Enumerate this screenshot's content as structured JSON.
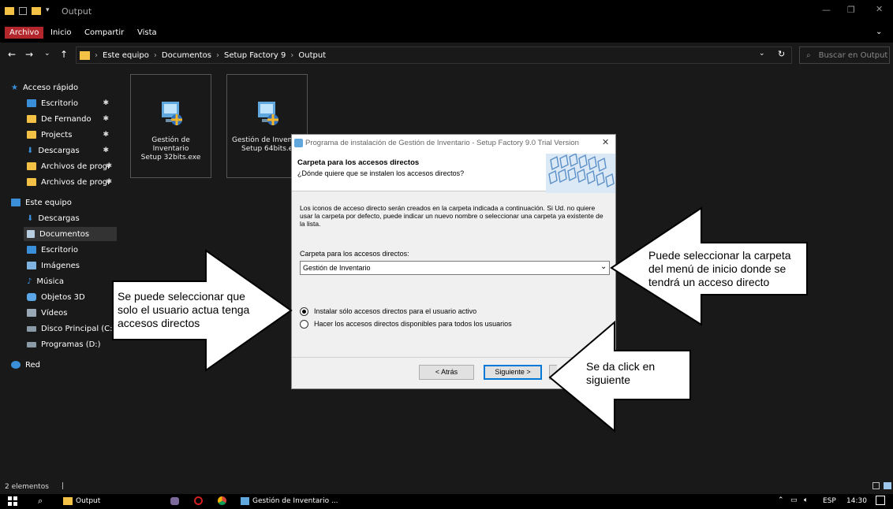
{
  "window": {
    "title": "Output"
  },
  "menu": [
    "Archivo",
    "Inicio",
    "Compartir",
    "Vista"
  ],
  "address": {
    "crumbs": [
      "Este equipo",
      "Documentos",
      "Setup Factory 9",
      "Output"
    ],
    "search_placeholder": "Buscar en Output"
  },
  "sidebar": {
    "quick_access": "Acceso rápido",
    "quick_items": [
      "Escritorio",
      "De Fernando",
      "Projects",
      "Descargas",
      "Archivos de progr",
      "Archivos de progr"
    ],
    "this_pc": "Este equipo",
    "pc_items": [
      "Descargas",
      "Documentos",
      "Escritorio",
      "Imágenes",
      "Música",
      "Objetos 3D",
      "Vídeos",
      "Disco Principal (C:)",
      "Programas (D:)"
    ],
    "network": "Red"
  },
  "files": [
    {
      "line1": "Gestión de Inventario",
      "line2": "Setup 32bits.exe"
    },
    {
      "line1": "Gestión de Invent",
      "line2": "Setup 64bits.ex"
    }
  ],
  "status": {
    "count": "2 elementos"
  },
  "taskbar": {
    "explorer": "Output",
    "setup": "Gestión de Inventario ...",
    "lang": "ESP",
    "time": "14:30"
  },
  "dialog": {
    "title": "Programa de instalación de Gestión de Inventario - Setup Factory 9.0 Trial Version",
    "heading": "Carpeta para los accesos directos",
    "subheading": "¿Dónde quiere que se instalen los accesos directos?",
    "description": "Los iconos de acceso directo serán creados en la carpeta indicada a continuación. Si Ud. no quiere usar la carpeta por defecto, puede indicar un nuevo nombre o seleccionar una carpeta ya existente de la lista.",
    "folder_label": "Carpeta para los accesos directos:",
    "folder_value": "Gestión de Inventario",
    "option1": "Instalar sólo accesos directos para el usuario activo",
    "option2": "Hacer los accesos directos disponibles para todos los usuarios",
    "back": "< Atrás",
    "next": "Siguiente >"
  },
  "callouts": {
    "left": "Se puede seleccionar que solo el usuario actua tenga accesos directos",
    "right": "Puede seleccionar la carpeta del menú de inicio donde se tendrá un acceso directo",
    "bottom": "Se da click en siguiente"
  }
}
